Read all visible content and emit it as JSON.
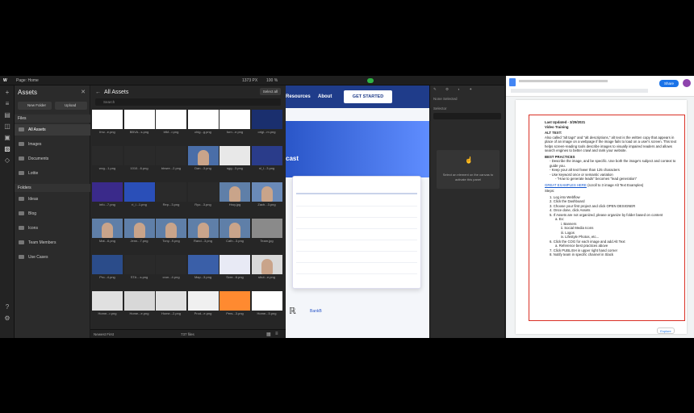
{
  "webflow": {
    "topbar": {
      "page_label": "Page: Home",
      "size_readout": "1373 PX",
      "zoom": "100 %"
    },
    "assets_panel": {
      "title": "Assets",
      "new_folder": "New Folder",
      "upload": "Upload",
      "files_header": "Files",
      "file_items": [
        "All Assets",
        "Images",
        "Documents",
        "Lottie"
      ],
      "folders_header": "Folders",
      "folders": [
        "Ideas",
        "Blog",
        "Icons",
        "Team Members",
        "Use Cases"
      ]
    },
    "assets_main": {
      "title": "All Assets",
      "select_all": "Select all",
      "search_placeholder": "Search",
      "sort_label": "Newest First",
      "count": "737 files",
      "tiles": [
        [
          "fmv...e.png",
          "BBVA...s.png",
          "bfkf...r.png",
          "chig...g.png",
          "forn...e.png",
          "origi...m.png"
        ],
        [
          "wvg...1.png",
          "1010...6.png",
          "bbwre...2.png",
          "Dan...3.png",
          "sgg...3.png",
          "nl_l...3.png"
        ],
        [
          "info...7.png",
          "ri_l...1.png",
          "Rep...3.png",
          "Ryo...3.png",
          "Hroy.jpg",
          "Zach...3.png"
        ],
        [
          "Mat...6.png",
          "Jenn...7.png",
          "Tony...9.png",
          "Rand...3.png",
          "Cath...3.png",
          "Team.jpg"
        ],
        [
          "Pro...4.png",
          "STA ...s.png",
          "crun...4.png",
          "Map...3.png",
          "Scre...6.png",
          "shut...e.png"
        ],
        [
          "Home...r.png",
          "Home...e.png",
          "Home...2.png",
          "Prod...e.png",
          "Pers...3.png",
          "Home...5.png"
        ]
      ]
    },
    "canvas": {
      "nav": [
        "Resources",
        "About"
      ],
      "cta": "GET STARTED",
      "hero_text": "cast",
      "logo_word": "BankB"
    },
    "style_panel": {
      "selector_label": "None Selected",
      "selector_sub": "Selector",
      "message": "Select an element on the canvas to activate this panel"
    }
  },
  "gdocs": {
    "share": "Share",
    "updated": "Last Updated - 3/29/2021",
    "doc_title": "Video Training",
    "alt_heading": "ALT TEXT:",
    "alt_body": "Also called \"alt tags\" and \"alt descriptions,\" alt text is the written copy that appears in place of an image on a webpage if the image fails to load on a user's screen. This text helps screen-reading tools describe images to visually impaired readers and allows search engines to better crawl and rank your website.",
    "best_heading": "BEST PRACTICES",
    "best": [
      "Describe the image, and be specific. Use both the image's subject and context to guide you.",
      "Keep your alt text fewer than 125 characters",
      "Use keyword once or semantic variation"
    ],
    "best_sub": "\"How to generate leads\" becomes \"lead generation\"",
    "examples_link": "GREAT EXAMPLES HERE",
    "examples_rest": "(scroll to 3 image Alt Text Examples)",
    "steps_heading": "Steps:",
    "steps": [
      "1. Log into Webflow",
      "2. Click the Dashboard",
      "3. Choose your first project and click OPEN DESIGNER",
      "4. Once done, click Assets",
      "5. If Assets are not organized, please organize by folder based on content",
      "6. Click the COG for each image and add Alt Text",
      "7. Click PUBLISH in upper right hand corner",
      "8. Notify team in specific channel in Slack"
    ],
    "step5_sub": "a. Ex:",
    "step5_items": [
      "i. Banners",
      "ii. Social Media Icons",
      "iii. Logos",
      "iv. Lifestyle Photos, etc..."
    ],
    "step6_sub": "a. Reference best practices above",
    "explore": "Explore"
  }
}
